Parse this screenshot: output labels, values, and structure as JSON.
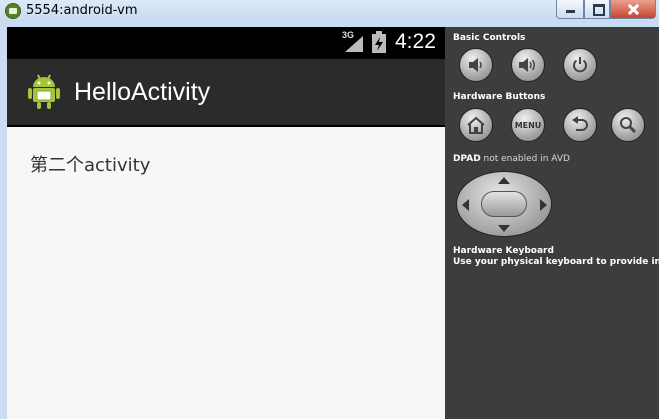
{
  "window": {
    "title": "5554:android-vm"
  },
  "device": {
    "statusbar": {
      "network": "3G",
      "time": "4:22"
    },
    "actionbar": {
      "title": "HelloActivity"
    },
    "content": {
      "text": "第二个activity"
    }
  },
  "panel": {
    "basic_controls_label": "Basic Controls",
    "hardware_buttons_label": "Hardware Buttons",
    "menu_label": "MENU",
    "dpad_label_strong": "DPAD",
    "dpad_label_rest": " not enabled in AVD",
    "keyboard_label": "Hardware Keyboard",
    "keyboard_hint": "Use your physical keyboard to provide input"
  },
  "colors": {
    "panel_bg": "#3d3d3d",
    "actionbar_bg": "#2b2b2b",
    "android_green": "#a4c639"
  }
}
